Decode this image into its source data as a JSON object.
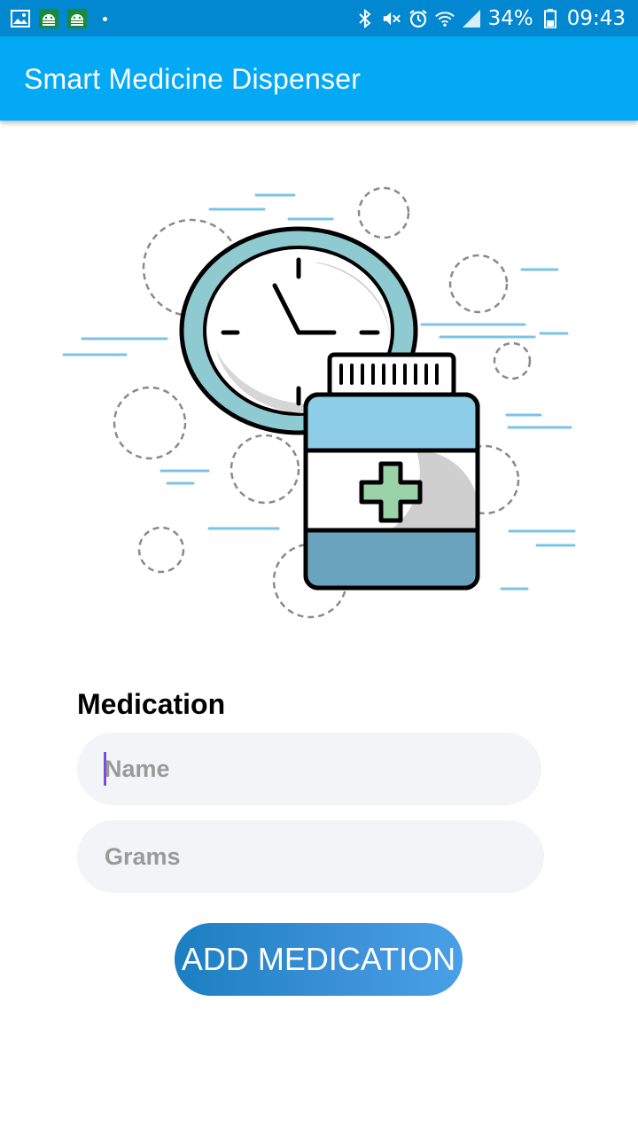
{
  "status_bar": {
    "battery": "34%",
    "time": "09:43",
    "icons": [
      "image-icon",
      "android-icon",
      "android-icon",
      "bluetooth-icon",
      "mute-icon",
      "alarm-icon",
      "wifi-icon",
      "signal-icon",
      "battery-icon"
    ]
  },
  "app_bar": {
    "title": "Smart Medicine Dispenser"
  },
  "form": {
    "section_label": "Medication",
    "name_placeholder": "Name",
    "grams_placeholder": "Grams",
    "add_button": "ADD MEDICATION"
  },
  "colors": {
    "status_bar": "#0288d1",
    "app_bar": "#03a9f4",
    "field_bg": "#f3f4f8",
    "button_start": "#1b7fc0",
    "button_end": "#4aa0e6"
  }
}
